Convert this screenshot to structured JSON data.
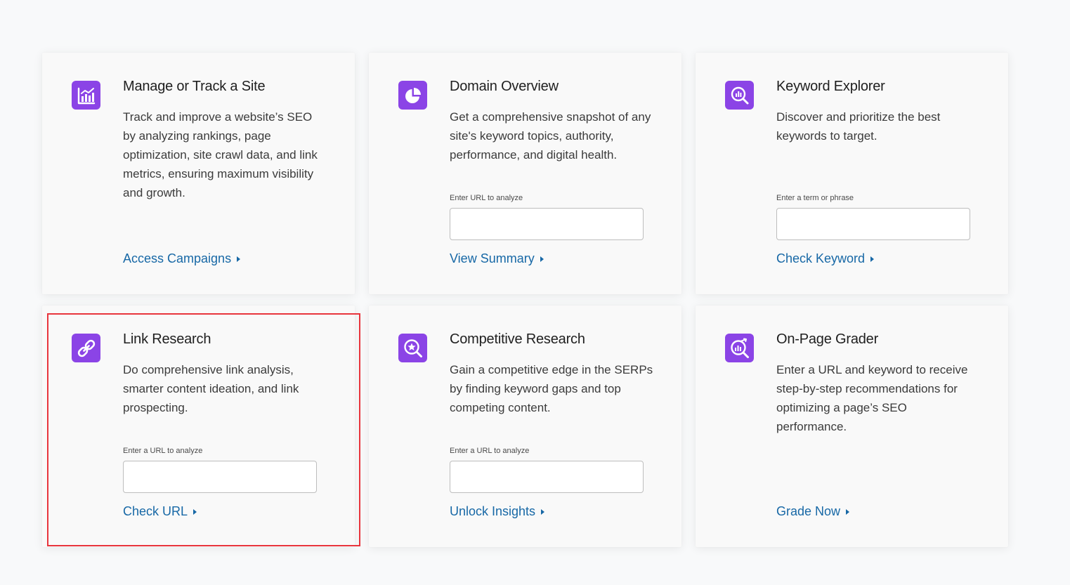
{
  "accent_color": "#8b44e6",
  "link_color": "#1768a6",
  "highlight_color": "#e8353d",
  "cards": [
    {
      "icon": "bar-chart-icon",
      "title": "Manage or Track a Site",
      "description": "Track and improve a website’s SEO by analyzing rankings, page optimization, site crawl data, and link metrics, ensuring maximum visibility and growth.",
      "link": "Access Campaigns"
    },
    {
      "icon": "pie-chart-icon",
      "title": "Domain Overview",
      "description": "Get a comprehensive snapshot of any site's keyword topics, authority, performance, and digital health.",
      "field_label": "Enter URL to analyze",
      "field_value": "",
      "link": "View Summary"
    },
    {
      "icon": "magnify-chart-icon",
      "title": "Keyword Explorer",
      "description": "Discover and prioritize the best keywords to target.",
      "field_label": "Enter a term or phrase",
      "field_value": "",
      "link": "Check Keyword"
    },
    {
      "icon": "link-icon",
      "title": "Link Research",
      "description": "Do comprehensive link analysis, smarter content ideation, and link prospecting.",
      "field_label": "Enter a URL to analyze",
      "field_value": "",
      "link": "Check URL",
      "highlighted": true
    },
    {
      "icon": "star-search-icon",
      "title": "Competitive Research",
      "description": "Gain a competitive edge in the SERPs by finding keyword gaps and top competing content.",
      "field_label": "Enter a URL to analyze",
      "field_value": "",
      "link": "Unlock Insights"
    },
    {
      "icon": "grader-search-icon",
      "title": "On-Page Grader",
      "description": "Enter a URL and keyword to receive step-by-step recommendations for optimizing a page’s SEO performance.",
      "link": "Grade Now"
    }
  ]
}
